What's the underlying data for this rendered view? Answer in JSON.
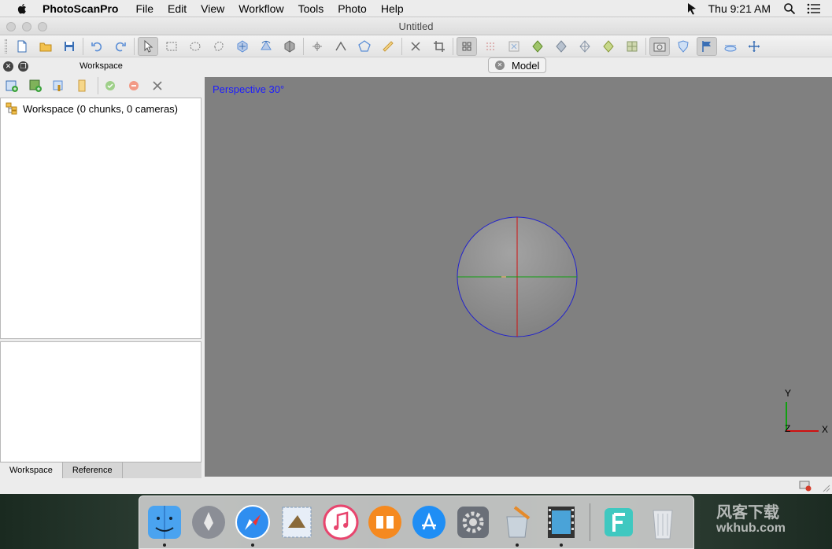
{
  "menubar": {
    "app_name": "PhotoScanPro",
    "menus": [
      "File",
      "Edit",
      "View",
      "Workflow",
      "Tools",
      "Photo",
      "Help"
    ],
    "clock": "Thu 9:21 AM"
  },
  "window": {
    "title": "Untitled"
  },
  "workspace_panel": {
    "title": "Workspace",
    "tree_root": "Workspace (0 chunks, 0 cameras)",
    "tabs": [
      "Workspace",
      "Reference"
    ]
  },
  "model_view": {
    "tab_label": "Model",
    "projection_label": "Perspective 30°",
    "axis_labels": {
      "y": "Y",
      "z": "Z",
      "x": "X"
    }
  },
  "watermark": {
    "line1": "风客下载",
    "line2": "wkhub.com"
  },
  "colors": {
    "viewport_bg": "#808080",
    "sphere_outline": "#2222cc",
    "axis_red": "#d01010",
    "axis_green": "#10a010",
    "projection_text": "#1c1cff"
  }
}
